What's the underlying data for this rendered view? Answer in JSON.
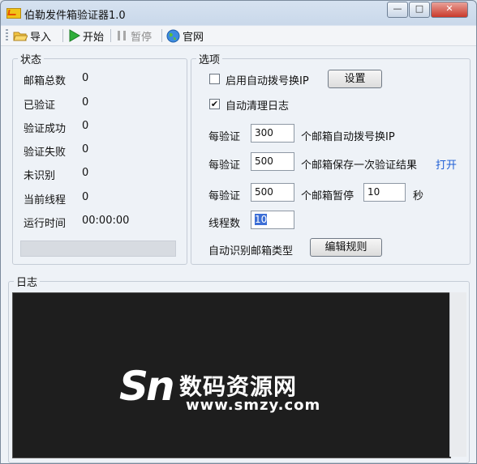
{
  "window": {
    "title": "伯勒发件箱验证器1.0",
    "controls": {
      "minimize": "—",
      "maximize": "□",
      "close": "✕"
    }
  },
  "toolbar": {
    "import_label": "导入",
    "start_label": "开始",
    "pause_label": "暂停",
    "website_label": "官网"
  },
  "status": {
    "legend": "状态",
    "rows": [
      {
        "label": "邮箱总数",
        "value": "0"
      },
      {
        "label": "已验证",
        "value": "0"
      },
      {
        "label": "验证成功",
        "value": "0"
      },
      {
        "label": "验证失败",
        "value": "0"
      },
      {
        "label": "未识别",
        "value": "0"
      },
      {
        "label": "当前线程",
        "value": "0"
      },
      {
        "label": "运行时间",
        "value": "00:00:00"
      }
    ],
    "progress": 0
  },
  "options": {
    "legend": "选项",
    "auto_dial": {
      "label": "启用自动拨号换IP",
      "checked": false,
      "button": "设置"
    },
    "auto_clean": {
      "label": "自动清理日志",
      "checked": true
    },
    "row1": {
      "prefix": "每验证",
      "value": "300",
      "suffix": "个邮箱自动拨号换IP"
    },
    "row2": {
      "prefix": "每验证",
      "value": "500",
      "suffix": "个邮箱保存一次验证结果",
      "link": "打开"
    },
    "row3": {
      "prefix": "每验证",
      "value": "500",
      "suffix": "个邮箱暂停",
      "seconds": "10",
      "unit": "秒"
    },
    "threads": {
      "label": "线程数",
      "value": "10"
    },
    "mailtype": {
      "label": "自动识别邮箱类型",
      "button": "编辑规则"
    }
  },
  "log": {
    "legend": "日志"
  },
  "watermark": {
    "logo": "Sn",
    "name": "数码资源网",
    "url": "www.smzy.com"
  },
  "colors": {
    "accent_link": "#1f5fd6",
    "log_bg": "#1e1e1e"
  }
}
